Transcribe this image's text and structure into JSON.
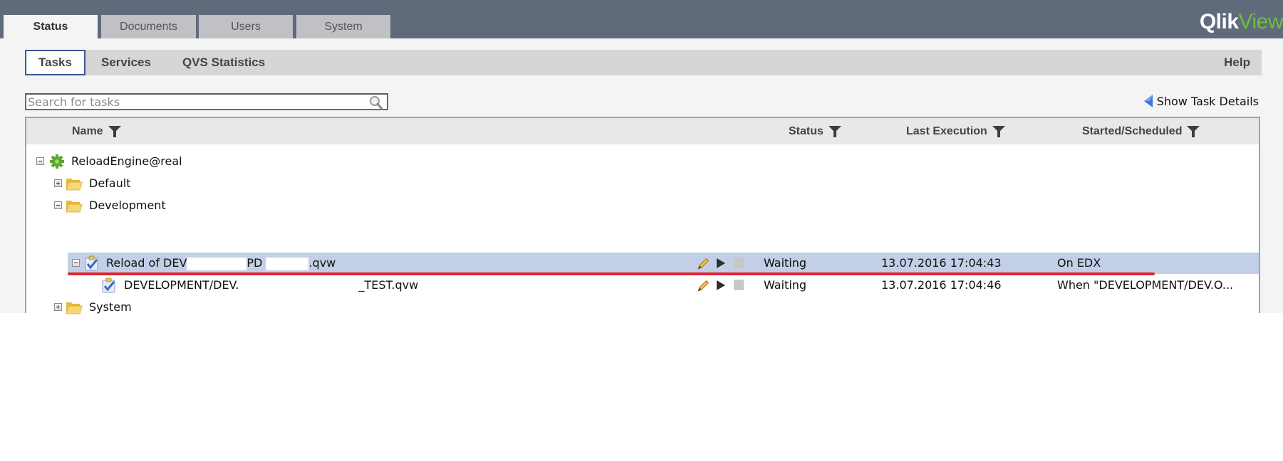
{
  "brand": {
    "logo_part1": "Qlik",
    "logo_part2": "View"
  },
  "main_tabs": [
    {
      "label": "Status",
      "active": true
    },
    {
      "label": "Documents",
      "active": false
    },
    {
      "label": "Users",
      "active": false
    },
    {
      "label": "System",
      "active": false
    }
  ],
  "sub_tabs": [
    {
      "label": "Tasks",
      "active": true
    },
    {
      "label": "Services",
      "active": false
    },
    {
      "label": "QVS Statistics",
      "active": false
    }
  ],
  "help_label": "Help",
  "search": {
    "placeholder": "Search for tasks",
    "value": ""
  },
  "show_task_details_label": "Show Task Details",
  "table": {
    "columns": [
      "Name",
      "Status",
      "Last Execution",
      "Started/Scheduled"
    ],
    "rows": [
      {
        "type": "engine",
        "expanded": true,
        "name": "ReloadEngine@real",
        "status": "",
        "last_execution": "",
        "started_scheduled": ""
      },
      {
        "type": "folder",
        "expanded": false,
        "name": "Default",
        "status": "",
        "last_execution": "",
        "started_scheduled": ""
      },
      {
        "type": "folder",
        "expanded": true,
        "name": "Development",
        "status": "",
        "last_execution": "",
        "started_scheduled": ""
      },
      {
        "type": "task",
        "expanded": true,
        "selected": true,
        "name_part1": "Reload of DEV",
        "name_part2": "PD",
        "name_part3": ".qvw",
        "status": "Waiting",
        "last_execution": "13.07.2016 17:04:43",
        "started_scheduled": "On EDX"
      },
      {
        "type": "task",
        "expanded": null,
        "selected": false,
        "name_part1": "DEVELOPMENT/DEV.",
        "name_part2": "_TEST.qvw",
        "status": "Waiting",
        "last_execution": "13.07.2016 17:04:46",
        "started_scheduled": "When \"DEVELOPMENT/DEV.O..."
      },
      {
        "type": "folder",
        "expanded": false,
        "name": "System",
        "status": "",
        "last_execution": "",
        "started_scheduled": ""
      }
    ]
  },
  "colors": {
    "topbar": "#5f6b7b",
    "brand_green": "#6cbf3f",
    "selected_row": "#c2cfe6",
    "annotation_red": "#e3232c",
    "active_tab_border": "#3a5795"
  }
}
